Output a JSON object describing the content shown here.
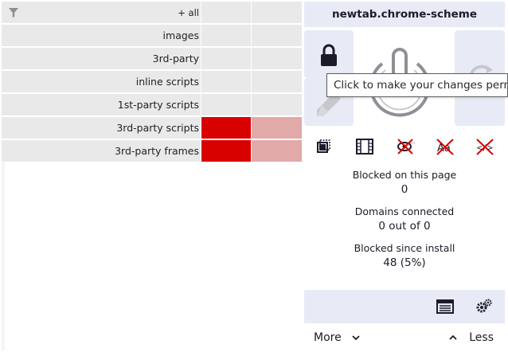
{
  "firewall": {
    "rows": [
      {
        "label": "+ all",
        "icon": "filter-icon"
      },
      {
        "label": "images"
      },
      {
        "label": "3rd-party"
      },
      {
        "label": "inline scripts"
      },
      {
        "label": "1st-party scripts"
      },
      {
        "label": "3rd-party scripts",
        "global": "blocked",
        "local": "blocked-weak"
      },
      {
        "label": "3rd-party frames",
        "global": "blocked",
        "local": "blocked-weak"
      }
    ],
    "colors": {
      "blocked": "#d90000",
      "blocked_weak": "#e2a9a9",
      "row_bg": "#e9e9ea"
    }
  },
  "panel": {
    "hostname": "newtab.chrome-scheme",
    "tooltip": "Click to make your changes permanent",
    "toolbar_icons": [
      "element-picker-icon",
      "media-icon",
      "no-cosmetic-filter-icon",
      "no-remote-fonts-icon",
      "no-scripting-icon"
    ],
    "stats": {
      "blocked_label": "Blocked on this page",
      "blocked_value": "0",
      "domains_label": "Domains connected",
      "domains_value": "0 out of 0",
      "since_label": "Blocked since install",
      "since_value": "48 (5%)"
    },
    "more_label": "More",
    "less_label": "Less",
    "accent_bg": "#e8ebf5",
    "icon_color": "#1c1b2c",
    "disabled_icon_color": "#c8c8cc"
  }
}
